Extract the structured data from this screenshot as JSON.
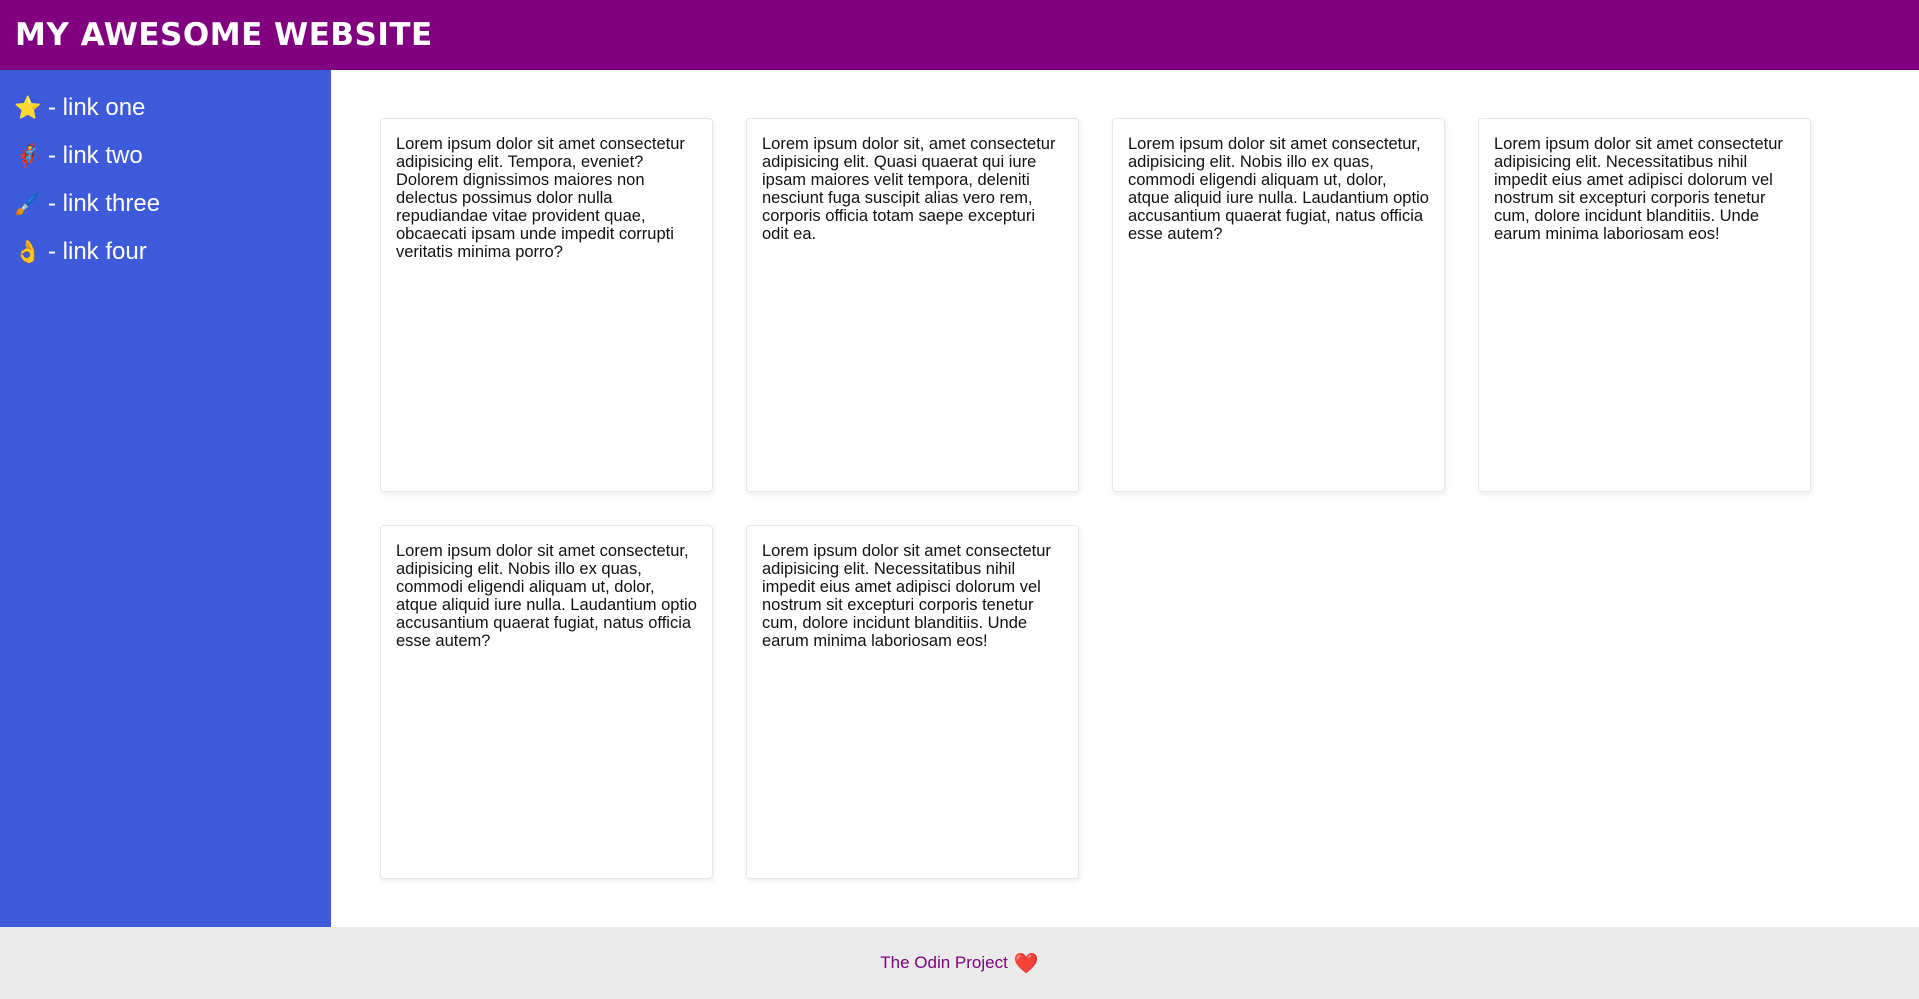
{
  "header": {
    "title": "MY AWESOME WEBSITE"
  },
  "sidebar": {
    "items": [
      {
        "icon": "star-icon",
        "glyph": "⭐",
        "label": "- link one"
      },
      {
        "icon": "person-icon",
        "glyph": "🦸",
        "label": "- link two"
      },
      {
        "icon": "paintbrush-icon",
        "glyph": "🖌️",
        "label": "- link three"
      },
      {
        "icon": "ok-hand-icon",
        "glyph": "👌",
        "label": "- link four"
      }
    ]
  },
  "main": {
    "cards": [
      {
        "text": "Lorem ipsum dolor sit amet consectetur adipisicing elit. Tempora, eveniet? Dolorem dignissimos maiores non delectus possimus dolor nulla repudiandae vitae provident quae, obcaecati ipsam unde impedit corrupti veritatis minima porro?"
      },
      {
        "text": "Lorem ipsum dolor sit, amet consectetur adipisicing elit. Quasi quaerat qui iure ipsam maiores velit tempora, deleniti nesciunt fuga suscipit alias vero rem, corporis officia totam saepe excepturi odit ea."
      },
      {
        "text": "Lorem ipsum dolor sit amet consectetur, adipisicing elit. Nobis illo ex quas, commodi eligendi aliquam ut, dolor, atque aliquid iure nulla. Laudantium optio accusantium quaerat fugiat, natus officia esse autem?"
      },
      {
        "text": "Lorem ipsum dolor sit amet consectetur adipisicing elit. Necessitatibus nihil impedit eius amet adipisci dolorum vel nostrum sit excepturi corporis tenetur cum, dolore incidunt blanditiis. Unde earum minima laboriosam eos!"
      },
      {
        "text": "Lorem ipsum dolor sit amet consectetur, adipisicing elit. Nobis illo ex quas, commodi eligendi aliquam ut, dolor, atque aliquid iure nulla. Laudantium optio accusantium quaerat fugiat, natus officia esse autem?"
      },
      {
        "text": "Lorem ipsum dolor sit amet consectetur adipisicing elit. Necessitatibus nihil impedit eius amet adipisci dolorum vel nostrum sit excepturi corporis tenetur cum, dolore incidunt blanditiis. Unde earum minima laboriosam eos!"
      }
    ]
  },
  "footer": {
    "link_text": "The Odin Project",
    "heart_glyph": "❤️",
    "heart_icon": "heart-icon"
  },
  "colors": {
    "header_bg": "#800080",
    "sidebar_bg": "#3d5adb",
    "footer_bg": "#eaeaea",
    "footer_link": "#800080"
  }
}
